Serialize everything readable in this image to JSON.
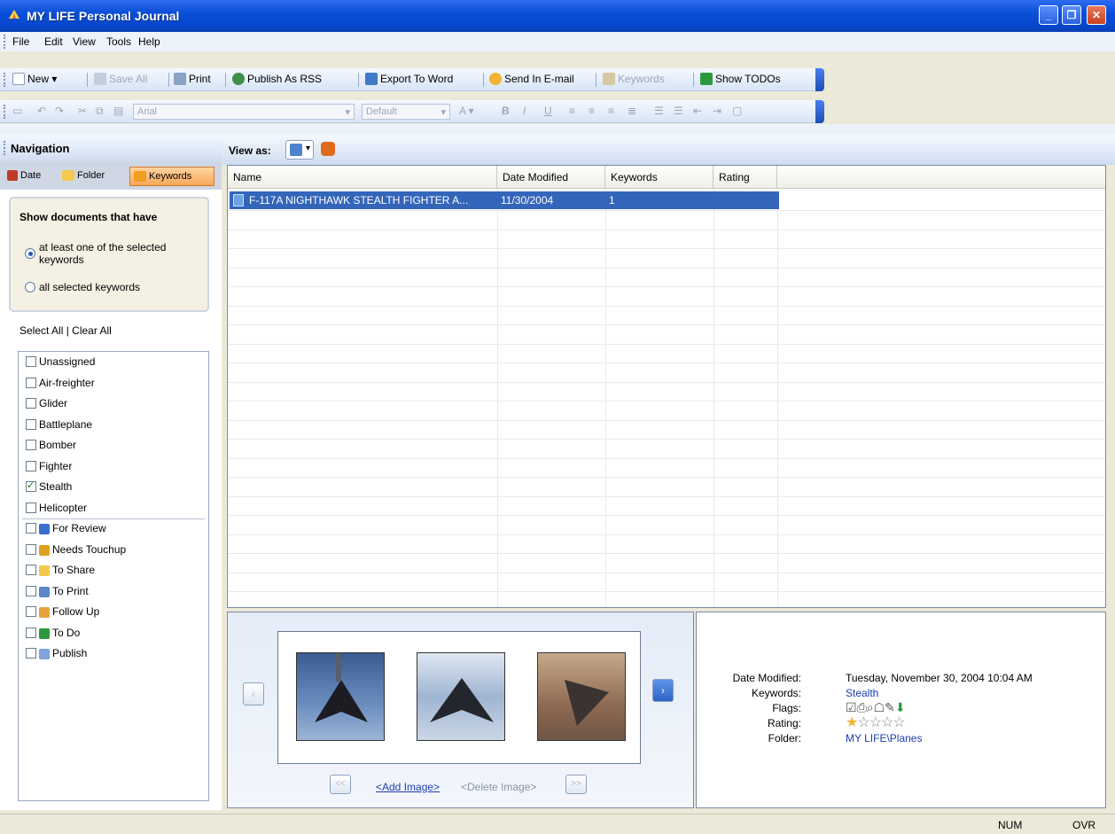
{
  "window": {
    "title": "MY LIFE Personal Journal"
  },
  "menu": [
    "File",
    "Edit",
    "View",
    "Tools",
    "Help"
  ],
  "toolbar1": {
    "new": "New",
    "save_all": "Save All",
    "print": "Print",
    "publish_rss": "Publish As RSS",
    "export_word": "Export To Word",
    "send_email": "Send In E-mail",
    "keywords": "Keywords",
    "show_todos": "Show TODOs"
  },
  "toolbar2": {
    "font": "Arial",
    "style": "Default"
  },
  "nav": {
    "title": "Navigation",
    "tabs": [
      "Date",
      "Folder",
      "Keywords"
    ],
    "show_title": "Show documents that have",
    "option1": "at least one of the selected keywords",
    "option2": "all selected keywords",
    "select_all": "Select All",
    "clear_all": "Clear All",
    "keywords": [
      {
        "label": "Unassigned",
        "checked": false
      },
      {
        "label": "Air-freighter",
        "checked": false
      },
      {
        "label": "Glider",
        "checked": false
      },
      {
        "label": "Battleplane",
        "checked": false
      },
      {
        "label": "Bomber",
        "checked": false
      },
      {
        "label": "Fighter",
        "checked": false
      },
      {
        "label": "Stealth",
        "checked": true
      },
      {
        "label": "Helicopter",
        "checked": false
      }
    ],
    "flags": [
      "For Review",
      "Needs Touchup",
      "To Share",
      "To Print",
      "Follow Up",
      "To Do",
      "Publish"
    ]
  },
  "view": {
    "label": "View as:"
  },
  "grid": {
    "columns": [
      "Name",
      "Date Modified",
      "Keywords",
      "Rating"
    ],
    "rows": [
      {
        "name": "F-117A NIGHTHAWK STEALTH FIGHTER A...",
        "date": "11/30/2004",
        "keywords": "1",
        "rating": ""
      }
    ]
  },
  "images": {
    "add": "<Add Image>",
    "delete": "<Delete Image>"
  },
  "details": {
    "date_label": "Date Modified:",
    "date_value": "Tuesday, November 30, 2004    10:04 AM",
    "keywords_label": "Keywords:",
    "keywords_value": "Stealth",
    "flags_label": "Flags:",
    "rating_label": "Rating:",
    "rating_value": 1,
    "rating_max": 5,
    "folder_label": "Folder:",
    "folder_value": "MY LIFE\\Planes"
  },
  "status": {
    "num": "NUM",
    "ovr": "OVR"
  }
}
